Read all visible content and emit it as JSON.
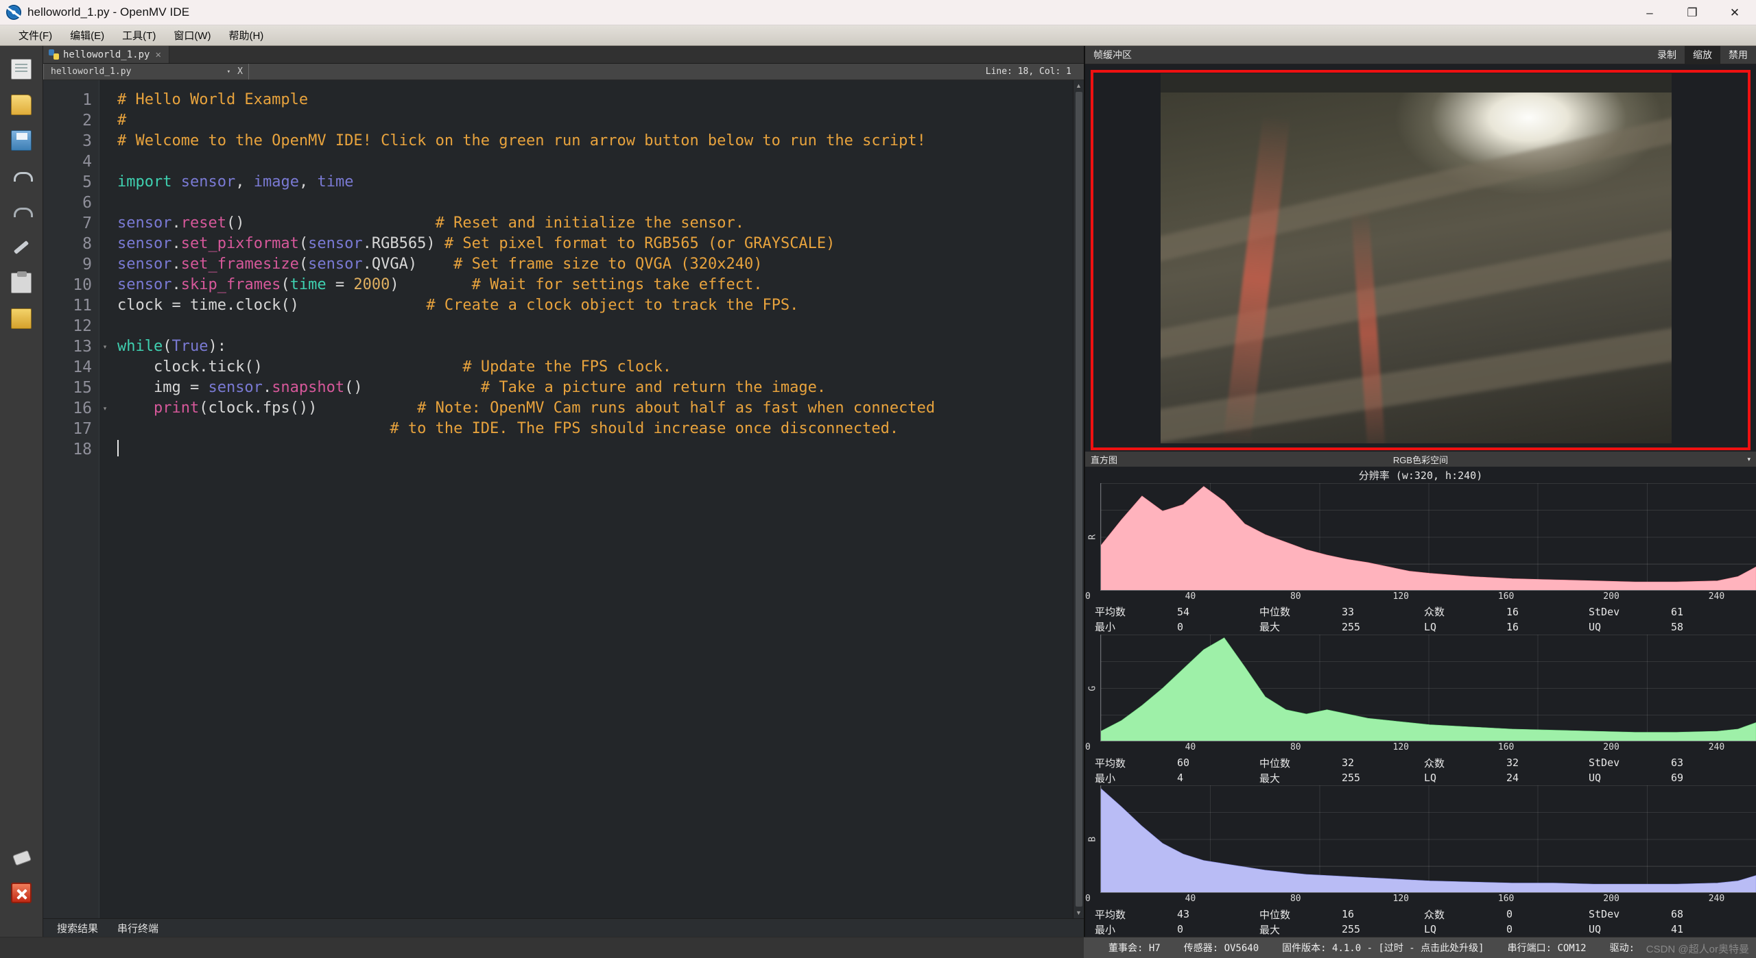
{
  "window": {
    "title": "helloworld_1.py - OpenMV IDE",
    "minimize": "–",
    "maximize": "❐",
    "close": "✕"
  },
  "menu": {
    "items": [
      {
        "label": "文件(F)"
      },
      {
        "label": "编辑(E)"
      },
      {
        "label": "工具(T)"
      },
      {
        "label": "窗口(W)"
      },
      {
        "label": "帮助(H)"
      }
    ]
  },
  "toolbar": {
    "icons": [
      "new-file-icon",
      "open-file-icon",
      "save-file-icon",
      "undo-icon",
      "redo-icon",
      "tools-icon",
      "paste-icon",
      "docs-icon",
      "connect-icon",
      "stop-icon"
    ]
  },
  "tabs": {
    "main": {
      "label": "helloworld_1.py",
      "close": "✕",
      "icon": "python-file-icon"
    },
    "sub": {
      "label": "helloworld_1.py",
      "caret": "▾",
      "close": "X"
    },
    "line_col": "Line: 18, Col: 1"
  },
  "editor": {
    "lines": [
      {
        "n": "1",
        "fold": "",
        "tokens": [
          {
            "t": "# Hello World Example",
            "c": "cm"
          }
        ]
      },
      {
        "n": "2",
        "fold": "",
        "tokens": [
          {
            "t": "#",
            "c": "cm"
          }
        ]
      },
      {
        "n": "3",
        "fold": "",
        "tokens": [
          {
            "t": "# Welcome to the OpenMV IDE! Click on the green run arrow button below to run the script!",
            "c": "cm"
          }
        ]
      },
      {
        "n": "4",
        "fold": "",
        "tokens": []
      },
      {
        "n": "5",
        "fold": "",
        "tokens": [
          {
            "t": "import",
            "c": "kw"
          },
          {
            "t": " ",
            "c": "pl"
          },
          {
            "t": "sensor",
            "c": "id"
          },
          {
            "t": ", ",
            "c": "pl"
          },
          {
            "t": "image",
            "c": "id"
          },
          {
            "t": ", ",
            "c": "pl"
          },
          {
            "t": "time",
            "c": "id"
          }
        ]
      },
      {
        "n": "6",
        "fold": "",
        "tokens": []
      },
      {
        "n": "7",
        "fold": "",
        "tokens": [
          {
            "t": "sensor",
            "c": "id"
          },
          {
            "t": ".",
            "c": "pl"
          },
          {
            "t": "reset",
            "c": "fn"
          },
          {
            "t": "()",
            "c": "pl"
          },
          {
            "t": "                     ",
            "c": "pl"
          },
          {
            "t": "# Reset and initialize the sensor.",
            "c": "cm"
          }
        ]
      },
      {
        "n": "8",
        "fold": "",
        "tokens": [
          {
            "t": "sensor",
            "c": "id"
          },
          {
            "t": ".",
            "c": "pl"
          },
          {
            "t": "set_pixformat",
            "c": "fn"
          },
          {
            "t": "(",
            "c": "pl"
          },
          {
            "t": "sensor",
            "c": "id"
          },
          {
            "t": ".RGB565)",
            "c": "pl"
          },
          {
            "t": " ",
            "c": "pl"
          },
          {
            "t": "# Set pixel format to RGB565 (or GRAYSCALE)",
            "c": "cm"
          }
        ]
      },
      {
        "n": "9",
        "fold": "",
        "tokens": [
          {
            "t": "sensor",
            "c": "id"
          },
          {
            "t": ".",
            "c": "pl"
          },
          {
            "t": "set_framesize",
            "c": "fn"
          },
          {
            "t": "(",
            "c": "pl"
          },
          {
            "t": "sensor",
            "c": "id"
          },
          {
            "t": ".QVGA)",
            "c": "pl"
          },
          {
            "t": "    ",
            "c": "pl"
          },
          {
            "t": "# Set frame size to QVGA (320x240)",
            "c": "cm"
          }
        ]
      },
      {
        "n": "10",
        "fold": "",
        "tokens": [
          {
            "t": "sensor",
            "c": "id"
          },
          {
            "t": ".",
            "c": "pl"
          },
          {
            "t": "skip_frames",
            "c": "fn"
          },
          {
            "t": "(",
            "c": "pl"
          },
          {
            "t": "time",
            "c": "kw"
          },
          {
            "t": " = ",
            "c": "pl"
          },
          {
            "t": "2000",
            "c": "nm"
          },
          {
            "t": ")",
            "c": "pl"
          },
          {
            "t": "        ",
            "c": "pl"
          },
          {
            "t": "# Wait for settings take effect.",
            "c": "cm"
          }
        ]
      },
      {
        "n": "11",
        "fold": "",
        "tokens": [
          {
            "t": "clock = ",
            "c": "pl"
          },
          {
            "t": "time",
            "c": "pl"
          },
          {
            "t": ".",
            "c": "pl"
          },
          {
            "t": "clock",
            "c": "pl"
          },
          {
            "t": "()",
            "c": "pl"
          },
          {
            "t": "              ",
            "c": "pl"
          },
          {
            "t": "# Create a clock object to track the FPS.",
            "c": "cm"
          }
        ]
      },
      {
        "n": "12",
        "fold": "",
        "tokens": []
      },
      {
        "n": "13",
        "fold": "▾",
        "tokens": [
          {
            "t": "while",
            "c": "kw"
          },
          {
            "t": "(",
            "c": "pl"
          },
          {
            "t": "True",
            "c": "id"
          },
          {
            "t": "):",
            "c": "pl"
          }
        ]
      },
      {
        "n": "14",
        "fold": "",
        "tokens": [
          {
            "t": "    clock.",
            "c": "pl"
          },
          {
            "t": "tick",
            "c": "pl"
          },
          {
            "t": "()",
            "c": "pl"
          },
          {
            "t": "                      ",
            "c": "pl"
          },
          {
            "t": "# Update the FPS clock.",
            "c": "cm"
          }
        ]
      },
      {
        "n": "15",
        "fold": "",
        "tokens": [
          {
            "t": "    img = ",
            "c": "pl"
          },
          {
            "t": "sensor",
            "c": "id"
          },
          {
            "t": ".",
            "c": "pl"
          },
          {
            "t": "snapshot",
            "c": "fn"
          },
          {
            "t": "()",
            "c": "pl"
          },
          {
            "t": "             ",
            "c": "pl"
          },
          {
            "t": "# Take a picture and return the image.",
            "c": "cm"
          }
        ]
      },
      {
        "n": "16",
        "fold": "▾",
        "tokens": [
          {
            "t": "    ",
            "c": "pl"
          },
          {
            "t": "print",
            "c": "fn"
          },
          {
            "t": "(clock.fps())",
            "c": "pl"
          },
          {
            "t": "           ",
            "c": "pl"
          },
          {
            "t": "# Note: OpenMV Cam runs about half as fast when connected",
            "c": "cm"
          }
        ]
      },
      {
        "n": "17",
        "fold": "",
        "tokens": [
          {
            "t": "                              ",
            "c": "pl"
          },
          {
            "t": "# to the IDE. The FPS should increase once disconnected.",
            "c": "cm"
          }
        ]
      },
      {
        "n": "18",
        "fold": "",
        "tokens": [],
        "cursor": true
      }
    ]
  },
  "bottom_panel": {
    "tabs": [
      {
        "label": "搜索结果"
      },
      {
        "label": "串行终端"
      }
    ]
  },
  "framebuffer": {
    "title": "帧缓冲区",
    "buttons": [
      {
        "label": "录制",
        "active": false
      },
      {
        "label": "缩放",
        "active": true
      },
      {
        "label": "禁用",
        "active": false
      }
    ]
  },
  "histogram": {
    "tab": "直方图",
    "colorspace": "RGB色彩空间",
    "caret": "▾",
    "resolution": "分辨率 (w:320, h:240)"
  },
  "chart_data": [
    {
      "type": "area",
      "title": "R",
      "channel": "R",
      "xlabel": "",
      "ylabel": "R",
      "xlim": [
        0,
        255
      ],
      "ylim": [
        0,
        1
      ],
      "grid": true,
      "color": "#ffb3bd",
      "tick_labels": [
        "0",
        "40",
        "80",
        "120",
        "160",
        "200",
        "240"
      ],
      "tick_values": [
        0,
        40,
        80,
        120,
        160,
        200,
        240
      ],
      "x": [
        0,
        8,
        16,
        24,
        32,
        40,
        48,
        56,
        64,
        72,
        80,
        88,
        96,
        104,
        112,
        120,
        128,
        144,
        160,
        176,
        192,
        208,
        224,
        240,
        248,
        255
      ],
      "values": [
        0.42,
        0.66,
        0.88,
        0.74,
        0.8,
        0.97,
        0.83,
        0.62,
        0.52,
        0.45,
        0.38,
        0.33,
        0.29,
        0.26,
        0.22,
        0.18,
        0.16,
        0.13,
        0.11,
        0.1,
        0.09,
        0.08,
        0.08,
        0.09,
        0.13,
        0.22
      ],
      "stats": {
        "平均数": "54",
        "中位数": "33",
        "众数": "16",
        "StDev": "61",
        "最小": "0",
        "最大": "255",
        "LQ": "16",
        "UQ": "58"
      }
    },
    {
      "type": "area",
      "title": "G",
      "channel": "G",
      "xlabel": "",
      "ylabel": "G",
      "xlim": [
        0,
        255
      ],
      "ylim": [
        0,
        1
      ],
      "grid": true,
      "color": "#9ef0a8",
      "tick_labels": [
        "0",
        "40",
        "80",
        "120",
        "160",
        "200",
        "240"
      ],
      "tick_values": [
        0,
        40,
        80,
        120,
        160,
        200,
        240
      ],
      "x": [
        0,
        8,
        16,
        24,
        32,
        40,
        48,
        56,
        64,
        72,
        80,
        88,
        96,
        104,
        112,
        120,
        128,
        144,
        160,
        176,
        192,
        208,
        224,
        240,
        248,
        255
      ],
      "values": [
        0.1,
        0.2,
        0.34,
        0.5,
        0.68,
        0.86,
        0.97,
        0.7,
        0.42,
        0.3,
        0.26,
        0.3,
        0.26,
        0.22,
        0.2,
        0.18,
        0.16,
        0.14,
        0.12,
        0.11,
        0.1,
        0.09,
        0.09,
        0.1,
        0.12,
        0.18
      ],
      "stats": {
        "平均数": "60",
        "中位数": "32",
        "众数": "32",
        "StDev": "63",
        "最小": "4",
        "最大": "255",
        "LQ": "24",
        "UQ": "69"
      }
    },
    {
      "type": "area",
      "title": "B",
      "channel": "B",
      "xlabel": "",
      "ylabel": "B",
      "xlim": [
        0,
        255
      ],
      "ylim": [
        0,
        1
      ],
      "grid": true,
      "color": "#b9bcf5",
      "tick_labels": [
        "0",
        "40",
        "80",
        "120",
        "160",
        "200",
        "240"
      ],
      "tick_values": [
        0,
        40,
        80,
        120,
        160,
        200,
        240
      ],
      "x": [
        0,
        8,
        16,
        24,
        32,
        40,
        48,
        56,
        64,
        72,
        80,
        88,
        96,
        104,
        112,
        120,
        128,
        144,
        160,
        176,
        192,
        208,
        224,
        240,
        248,
        255
      ],
      "values": [
        0.97,
        0.8,
        0.62,
        0.46,
        0.36,
        0.3,
        0.27,
        0.24,
        0.21,
        0.19,
        0.17,
        0.16,
        0.15,
        0.14,
        0.13,
        0.12,
        0.11,
        0.1,
        0.09,
        0.09,
        0.08,
        0.08,
        0.08,
        0.09,
        0.11,
        0.16
      ],
      "stats": {
        "平均数": "43",
        "中位数": "16",
        "众数": "0",
        "StDev": "68",
        "最小": "0",
        "最大": "255",
        "LQ": "0",
        "UQ": "41"
      }
    }
  ],
  "stat_labels": {
    "mean": "平均数",
    "median": "中位数",
    "mode": "众数",
    "stdev": "StDev",
    "min": "最小",
    "max": "最大",
    "lq": "LQ",
    "uq": "UQ"
  },
  "statusbar": {
    "board": "董事会: H7",
    "sensor": "传感器: OV5640",
    "firmware": "固件版本: 4.1.0 - [过时 - 点击此处升级]",
    "port": "串行端口: COM12",
    "driver": "驱动:",
    "watermark": "CSDN @超人or奥特曼"
  }
}
